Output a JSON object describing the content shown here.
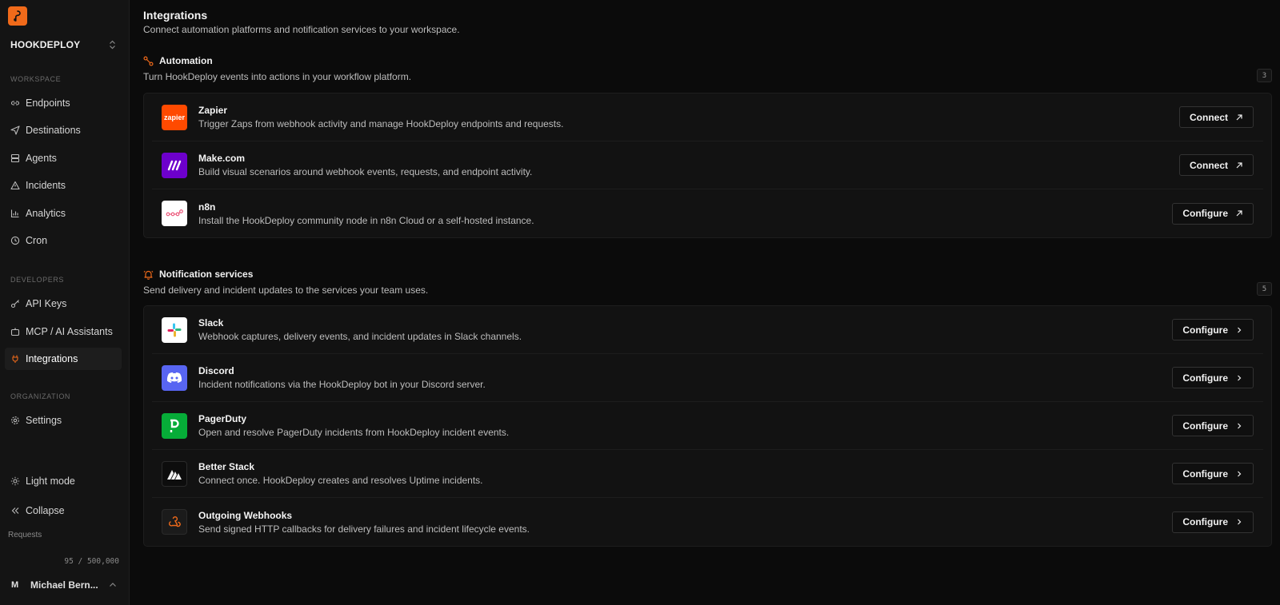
{
  "sidebar": {
    "workspace_name": "HOOKDEPLOY",
    "sections": {
      "workspace": "WORKSPACE",
      "developers": "DEVELOPERS",
      "organization": "ORGANIZATION"
    },
    "items": {
      "endpoints": "Endpoints",
      "destinations": "Destinations",
      "agents": "Agents",
      "incidents": "Incidents",
      "analytics": "Analytics",
      "cron": "Cron",
      "api_keys": "API Keys",
      "mcp": "MCP / AI Assistants",
      "integrations": "Integrations",
      "settings": "Settings",
      "light_mode": "Light mode",
      "collapse": "Collapse"
    },
    "active_item": "Integrations",
    "requests_label": "Requests",
    "requests_count": "95 / 500,000",
    "user_initial": "M",
    "user_name": "Michael Bern..."
  },
  "page": {
    "title": "Integrations",
    "subtitle": "Connect automation platforms and notification services to your workspace."
  },
  "automation": {
    "title": "Automation",
    "description": "Turn HookDeploy events into actions in your workflow platform.",
    "count": "3",
    "items": [
      {
        "name": "Zapier",
        "description": "Trigger Zaps from webhook activity and manage HookDeploy endpoints and requests.",
        "action": "Connect",
        "icon_text": "zapier"
      },
      {
        "name": "Make.com",
        "description": "Build visual scenarios around webhook events, requests, and endpoint activity.",
        "action": "Connect"
      },
      {
        "name": "n8n",
        "description": "Install the HookDeploy community node in n8n Cloud or a self-hosted instance.",
        "action": "Configure"
      }
    ]
  },
  "notifications": {
    "title": "Notification services",
    "description": "Send delivery and incident updates to the services your team uses.",
    "count": "5",
    "items": [
      {
        "name": "Slack",
        "description": "Webhook captures, delivery events, and incident updates in Slack channels.",
        "action": "Configure"
      },
      {
        "name": "Discord",
        "description": "Incident notifications via the HookDeploy bot in your Discord server.",
        "action": "Configure"
      },
      {
        "name": "PagerDuty",
        "description": "Open and resolve PagerDuty incidents from HookDeploy incident events.",
        "action": "Configure"
      },
      {
        "name": "Better Stack",
        "description": "Connect once. HookDeploy creates and resolves Uptime incidents.",
        "action": "Configure"
      },
      {
        "name": "Outgoing Webhooks",
        "description": "Send signed HTTP callbacks for delivery failures and incident lifecycle events.",
        "action": "Configure"
      }
    ]
  },
  "colors": {
    "accent": "#f06a1a",
    "zapier": "#ff4a00",
    "make": "#6d00cc",
    "discord": "#5865f2",
    "pagerduty": "#06ac38"
  }
}
